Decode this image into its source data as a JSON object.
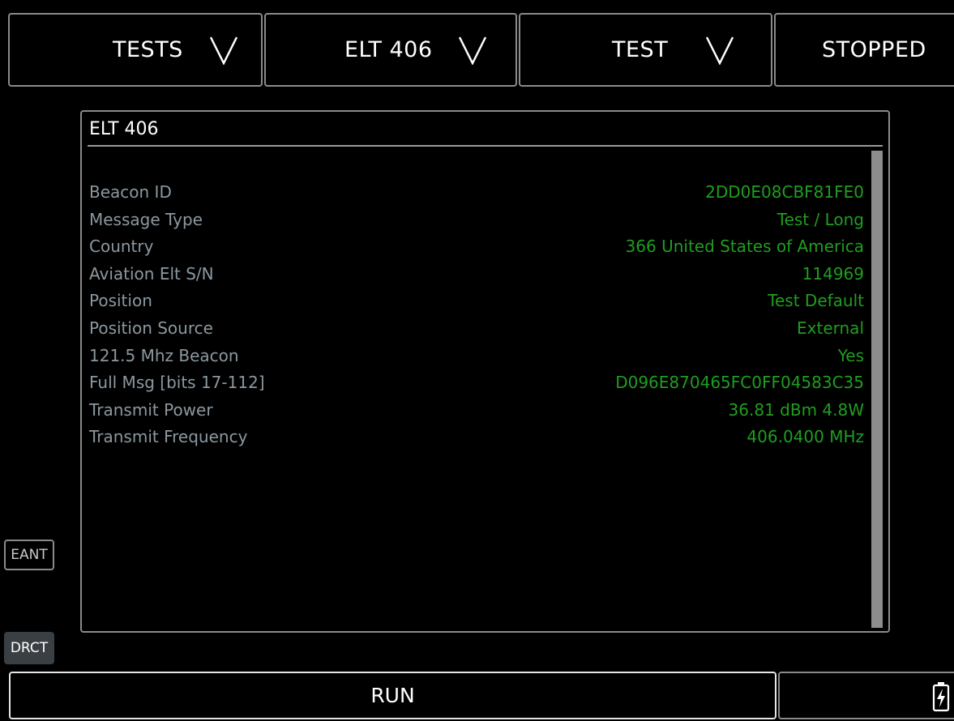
{
  "header": {
    "tests_label": "TESTS",
    "mode_label": "ELT 406",
    "test_label": "TEST",
    "status_label": "STOPPED"
  },
  "panel": {
    "title": "ELT 406",
    "rows": [
      {
        "label": "Beacon ID",
        "value": "2DD0E08CBF81FE0"
      },
      {
        "label": "Message Type",
        "value": "Test / Long"
      },
      {
        "label": "Country",
        "value": "366 United States of America"
      },
      {
        "label": "Aviation Elt S/N",
        "value": "114969"
      },
      {
        "label": "Position",
        "value": "Test Default"
      },
      {
        "label": "Position Source",
        "value": "External"
      },
      {
        "label": "121.5 Mhz Beacon",
        "value": "Yes"
      },
      {
        "label": "Full Msg [bits 17-112]",
        "value": "D096E870465FC0FF04583C35"
      },
      {
        "label": "Transmit Power",
        "value": "36.81 dBm 4.8W"
      },
      {
        "label": "Transmit Frequency",
        "value": "406.0400 MHz"
      }
    ]
  },
  "side": {
    "eant_label": "EANT",
    "drct_label": "DRCT"
  },
  "footer": {
    "run_label": "RUN",
    "battery_icon": "battery-charging-icon"
  },
  "colors": {
    "background": "#000000",
    "label": "#8b98a0",
    "value": "#1f9e1f",
    "border": "#8a8a8a"
  }
}
